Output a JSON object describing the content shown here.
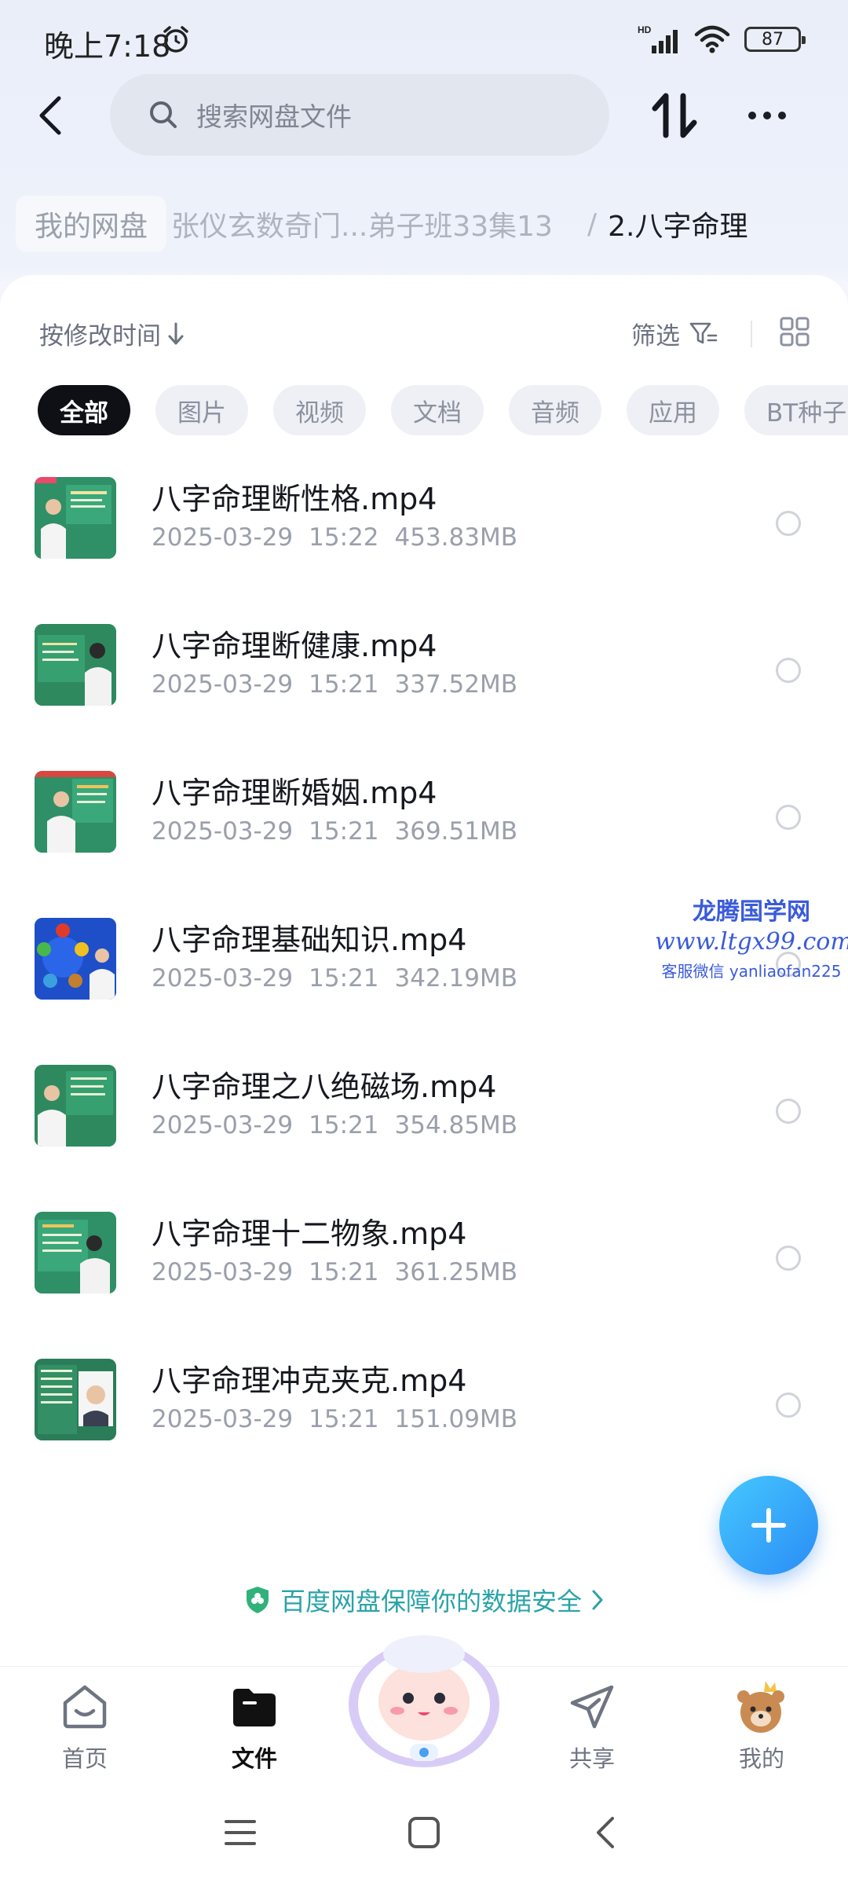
{
  "status_bar": {
    "time": "晚上7:18",
    "network": "HD",
    "battery": "87"
  },
  "header": {
    "search_placeholder": "搜索网盘文件"
  },
  "breadcrumb": {
    "root": "我的网盘",
    "middle": "张仪玄数奇门...弟子班33集13",
    "separator": "/",
    "current": "2.八字命理"
  },
  "toolbar": {
    "sort_label": "按修改时间",
    "filter_label": "筛选"
  },
  "tabs": [
    "全部",
    "图片",
    "视频",
    "文档",
    "音频",
    "应用",
    "BT种子"
  ],
  "files": [
    {
      "name": "八字命理断性格.mp4",
      "date": "2025-03-29",
      "time": "15:22",
      "size": "453.83MB"
    },
    {
      "name": "八字命理断健康.mp4",
      "date": "2025-03-29",
      "time": "15:21",
      "size": "337.52MB"
    },
    {
      "name": "八字命理断婚姻.mp4",
      "date": "2025-03-29",
      "time": "15:21",
      "size": "369.51MB"
    },
    {
      "name": "八字命理基础知识.mp4",
      "date": "2025-03-29",
      "time": "15:21",
      "size": "342.19MB"
    },
    {
      "name": "八字命理之八绝磁场.mp4",
      "date": "2025-03-29",
      "time": "15:21",
      "size": "354.85MB"
    },
    {
      "name": "八字命理十二物象.mp4",
      "date": "2025-03-29",
      "time": "15:21",
      "size": "361.25MB"
    },
    {
      "name": "八字命理冲克夹克.mp4",
      "date": "2025-03-29",
      "time": "15:21",
      "size": "151.09MB"
    }
  ],
  "watermark": {
    "line1": "龙腾国学网",
    "line2": "www.ltgx99.com",
    "line3": "客服微信 yanliaofan225"
  },
  "security_tip": "百度网盘保障你的数据安全",
  "bottom_nav": [
    {
      "label": "首页",
      "icon": "home-icon"
    },
    {
      "label": "文件",
      "icon": "folder-icon"
    },
    {
      "label": "共享",
      "icon": "send-icon"
    },
    {
      "label": "我的",
      "icon": "avatar-icon"
    }
  ],
  "colors": {
    "accent": "#2a8cf5",
    "active_tab": "#0e1016",
    "tip": "#2aa3a8",
    "watermark": "#3a5bd9"
  }
}
